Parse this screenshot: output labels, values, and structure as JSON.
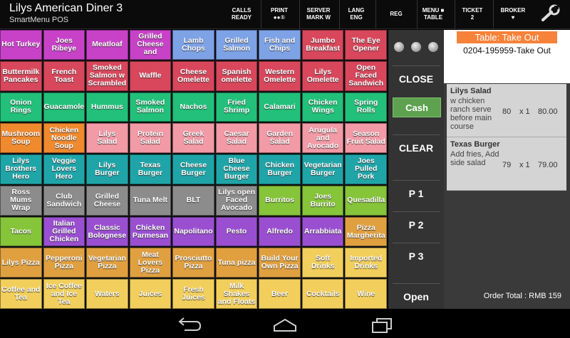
{
  "app": {
    "title": "Lilys American Diner 3",
    "subtitle": "SmartMenu POS"
  },
  "toolbar": [
    {
      "name": "calls-ready-button",
      "line1": "CALLS",
      "line2": "READY"
    },
    {
      "name": "print-button",
      "line1": "PRINT",
      "line2": "●●①"
    },
    {
      "name": "server-button",
      "line1": "SERVER",
      "line2": "MARK W"
    },
    {
      "name": "lang-button",
      "line1": "LANG",
      "line2": "ENG"
    },
    {
      "name": "reg-button",
      "line1": "REG",
      "line2": ""
    },
    {
      "name": "menu-table-button",
      "line1": "MENU ■",
      "line2": "TABLE"
    },
    {
      "name": "ticket-button",
      "line1": "TICKET",
      "line2": "2"
    },
    {
      "name": "broker-button",
      "line1": "BROKER",
      "line2": "♥"
    }
  ],
  "menu_tiles": [
    {
      "label": "Hot Turkey",
      "color": "#c842c8"
    },
    {
      "label": "Joes Ribeye",
      "color": "#c842c8"
    },
    {
      "label": "Meatloaf",
      "color": "#c842c8"
    },
    {
      "label": "Grilled Cheese and",
      "color": "#c842c8"
    },
    {
      "label": "Lamb Chops",
      "color": "#7ea2e6"
    },
    {
      "label": "Grilled Salmon",
      "color": "#7ea2e6"
    },
    {
      "label": "Fish and Chips",
      "color": "#7ea2e6"
    },
    {
      "label": "Jumbo Breakfast",
      "color": "#d8475c"
    },
    {
      "label": "The Eye Opener",
      "color": "#d8475c"
    },
    {
      "label": "Buttermilk Pancakes",
      "color": "#d8475c"
    },
    {
      "label": "French Toast",
      "color": "#d8475c"
    },
    {
      "label": "Smoked Salmon w Scrambled",
      "color": "#d8475c"
    },
    {
      "label": "Waffle",
      "color": "#d8475c"
    },
    {
      "label": "Cheese Omelette",
      "color": "#d8475c"
    },
    {
      "label": "Spanish omelette",
      "color": "#d8475c"
    },
    {
      "label": "Western Omelette",
      "color": "#d8475c"
    },
    {
      "label": "Lilys Omelette",
      "color": "#d8475c"
    },
    {
      "label": "Open Faced Sandwich",
      "color": "#d8475c"
    },
    {
      "label": "Onion Rings",
      "color": "#22c07a"
    },
    {
      "label": "Guacamole",
      "color": "#22c07a"
    },
    {
      "label": "Hummus",
      "color": "#22c07a"
    },
    {
      "label": "Smoked Salmon",
      "color": "#22c07a"
    },
    {
      "label": "Nachos",
      "color": "#22c07a"
    },
    {
      "label": "Fried Shrimp",
      "color": "#22c07a"
    },
    {
      "label": "Calamari",
      "color": "#22c07a"
    },
    {
      "label": "Chicken Wings",
      "color": "#22c07a"
    },
    {
      "label": "Spring Rolls",
      "color": "#22c07a"
    },
    {
      "label": "Mushroom Soup",
      "color": "#f08a2e"
    },
    {
      "label": "Chicken Noodle Soup",
      "color": "#f08a2e"
    },
    {
      "label": "Lilys Salad",
      "color": "#f29aa6"
    },
    {
      "label": "Protein Salad",
      "color": "#f29aa6"
    },
    {
      "label": "Greek Salad",
      "color": "#f29aa6"
    },
    {
      "label": "Caesar Salad",
      "color": "#f29aa6"
    },
    {
      "label": "Garden Salad",
      "color": "#f29aa6"
    },
    {
      "label": "Arugula and Avocado",
      "color": "#f29aa6"
    },
    {
      "label": "Season Fruit Salad",
      "color": "#f29aa6"
    },
    {
      "label": "Lilys Brothers Hero",
      "color": "#1fa5a8"
    },
    {
      "label": "Veggie Lovers Hero",
      "color": "#1fa5a8"
    },
    {
      "label": "Lilys Burger",
      "color": "#1fa5a8"
    },
    {
      "label": "Texas Burger",
      "color": "#1fa5a8"
    },
    {
      "label": "Cheese Burger",
      "color": "#1fa5a8"
    },
    {
      "label": "Blue Cheese Burger",
      "color": "#1fa5a8"
    },
    {
      "label": "Chicken Burger",
      "color": "#1fa5a8"
    },
    {
      "label": "Vegetarian Burger",
      "color": "#1fa5a8"
    },
    {
      "label": "Joes Pulled Pork",
      "color": "#1fa5a8"
    },
    {
      "label": "Ross Mums Wrap",
      "color": "#8c8c8c"
    },
    {
      "label": "Club Sandwich",
      "color": "#8c8c8c"
    },
    {
      "label": "Grilled Cheese",
      "color": "#8c8c8c"
    },
    {
      "label": "Tuna Melt",
      "color": "#8c8c8c"
    },
    {
      "label": "BLT",
      "color": "#8c8c8c"
    },
    {
      "label": "Lilys open Faced Avocado",
      "color": "#8c8c8c"
    },
    {
      "label": "Burritos",
      "color": "#86c43a"
    },
    {
      "label": "Joes Burrito",
      "color": "#86c43a"
    },
    {
      "label": "Quesadilla",
      "color": "#86c43a"
    },
    {
      "label": "Tacos",
      "color": "#86c43a"
    },
    {
      "label": "Italian Grilled Chicken",
      "color": "#9a4fd1"
    },
    {
      "label": "Classic Bolognese",
      "color": "#9a4fd1"
    },
    {
      "label": "Chicken Parmesan",
      "color": "#9a4fd1"
    },
    {
      "label": "Napolitano",
      "color": "#9a4fd1"
    },
    {
      "label": "Pesto",
      "color": "#9a4fd1"
    },
    {
      "label": "Alfredo",
      "color": "#9a4fd1"
    },
    {
      "label": "Arrabbiata",
      "color": "#9a4fd1"
    },
    {
      "label": "Pizza Margherita",
      "color": "#e0a040"
    },
    {
      "label": "Lilys Pizza",
      "color": "#e0a040"
    },
    {
      "label": "Pepperoni Pizza",
      "color": "#e0a040"
    },
    {
      "label": "Vegetarian Pizza",
      "color": "#e0a040"
    },
    {
      "label": "Meat Lovers Pizza",
      "color": "#e0a040"
    },
    {
      "label": "Prosciutto Pizza",
      "color": "#e0a040"
    },
    {
      "label": "Tuna pizza",
      "color": "#e0a040"
    },
    {
      "label": "Build Your Own Pizza",
      "color": "#e0a040"
    },
    {
      "label": "Soft Drinks",
      "color": "#f2cf5c"
    },
    {
      "label": "Imported Drinks",
      "color": "#f2cf5c"
    },
    {
      "label": "Coffee and Tea",
      "color": "#f2cf5c"
    },
    {
      "label": "Ice Coffee and Ice Tea",
      "color": "#f2cf5c"
    },
    {
      "label": "Waters",
      "color": "#f2cf5c"
    },
    {
      "label": "Juices",
      "color": "#f2cf5c"
    },
    {
      "label": "Fresh Juices",
      "color": "#f2cf5c"
    },
    {
      "label": "Milk Shakes and Floats",
      "color": "#f2cf5c"
    },
    {
      "label": "Beer",
      "color": "#f2cf5c"
    },
    {
      "label": "Cocktails",
      "color": "#f2cf5c"
    },
    {
      "label": "Wine",
      "color": "#f2cf5c"
    }
  ],
  "actions": {
    "close": "CLOSE",
    "cash": "Cash",
    "clear": "CLEAR",
    "p1": "P 1",
    "p2": "P 2",
    "p3": "P 3",
    "open": "Open"
  },
  "order": {
    "table_label": "Table: Take Out",
    "order_no": "0204-195959-Take Out",
    "items": [
      {
        "name": "Lilys Salad",
        "note": "w chicken ranch serve before main course",
        "price": "80",
        "qty": "x 1",
        "total": "80.00"
      },
      {
        "name": "Texas Burger",
        "note": "Add fries, Add side salad",
        "price": "79",
        "qty": "x 1",
        "total": "79.00"
      }
    ],
    "total_label": "Order Total : RMB 159"
  },
  "colors": {
    "accent_orange": "#f7823a",
    "cash_green": "#5ea14f"
  }
}
